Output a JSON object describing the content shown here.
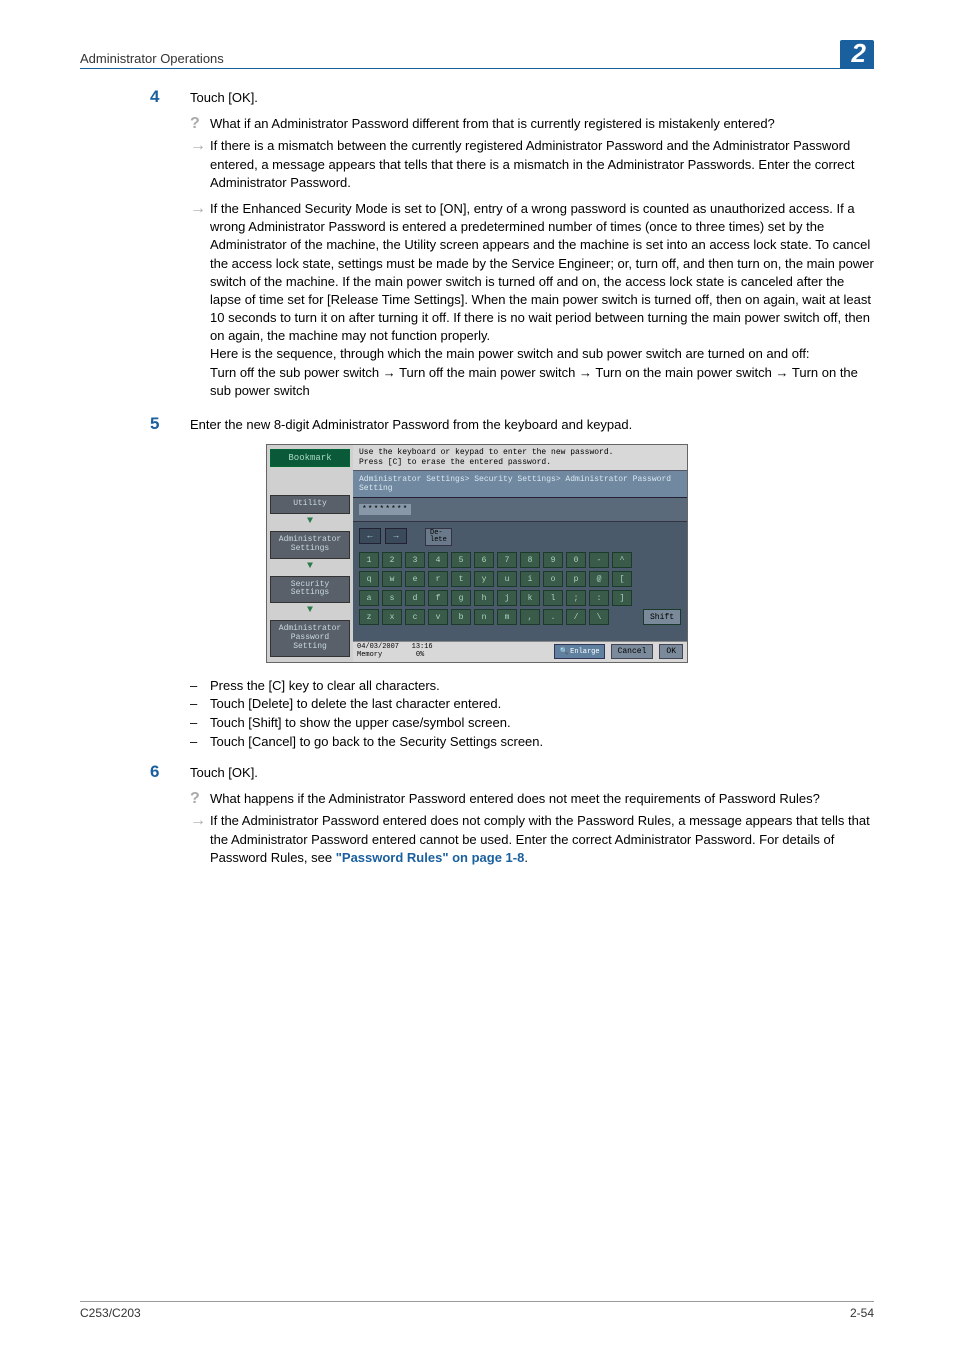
{
  "header": {
    "title": "Administrator Operations",
    "chapter": "2"
  },
  "steps": {
    "s4": {
      "num": "4",
      "text": "Touch [OK]."
    },
    "s5": {
      "num": "5",
      "text": "Enter the new 8-digit Administrator Password from the keyboard and keypad."
    },
    "s6": {
      "num": "6",
      "text": "Touch [OK]."
    }
  },
  "qa4": {
    "q": "What if an Administrator Password different from that is currently registered is mistakenly entered?",
    "a1": "If there is a mismatch between the currently registered Administrator Password and the Administrator Password entered, a message appears that tells that there is a mismatch in the Administrator Passwords. Enter the correct Administrator Password.",
    "a2a": "If the Enhanced Security Mode is set to [ON], entry of a wrong password is counted as unauthorized access. If a wrong Administrator Password is entered a predetermined number of times (once to three times) set by the Administrator of the machine, the Utility screen appears and the machine is set into an access lock state. To cancel the access lock state, settings must be made by the Service Engineer; or, turn off, and then turn on, the main power switch of the machine. If the main power switch is turned off and on, the access lock state is canceled after the lapse of time set for [Release Time Settings]. When the main power switch is turned off, then on again, wait at least 10 seconds to turn it on after turning it off. If there is no wait period between turning the main power switch off, then on again, the machine may not function properly.",
    "a2b": "Here is the sequence, through which the main power switch and sub power switch are turned on and off:",
    "a2c": "Turn off the sub power switch → Turn off the main power switch → Turn on the main power switch → Turn on the sub power switch"
  },
  "bullets5": {
    "b1": "Press the [C] key to clear all characters.",
    "b2": "Touch [Delete] to delete the last character entered.",
    "b3": "Touch [Shift] to show the upper case/symbol screen.",
    "b4": "Touch [Cancel] to go back to the Security Settings screen."
  },
  "qa6": {
    "q": "What happens if the Administrator Password entered does not meet the requirements of Password Rules?",
    "a_pre": "If the Administrator Password entered does not comply with the Password Rules, a message appears that tells that the Administrator Password entered cannot be used. Enter the correct Administrator Password. For details of Password Rules, see ",
    "a_link": "\"Password Rules\" on page 1-8",
    "a_post": "."
  },
  "screenshot": {
    "instr1": "Use the keyboard or keypad to enter the new password.",
    "instr2": "Press [C] to erase the entered password.",
    "breadcrumb": "Administrator Settings> Security Settings> Administrator Password Setting",
    "input_value": "********",
    "bookmark": "Bookmark",
    "side": {
      "utility": "Utility",
      "admin": "Administrator Settings",
      "security": "Security Settings",
      "pwd": "Administrator Password Setting"
    },
    "nav": {
      "left": "←",
      "right": "→",
      "delete": "De-\nlete"
    },
    "rows": {
      "r1": [
        "1",
        "2",
        "3",
        "4",
        "5",
        "6",
        "7",
        "8",
        "9",
        "0",
        "-",
        "^"
      ],
      "r2": [
        "q",
        "w",
        "e",
        "r",
        "t",
        "y",
        "u",
        "i",
        "o",
        "p",
        "@",
        "["
      ],
      "r3": [
        "a",
        "s",
        "d",
        "f",
        "g",
        "h",
        "j",
        "k",
        "l",
        ";",
        ":",
        "]"
      ],
      "r4": [
        "z",
        "x",
        "c",
        "v",
        "b",
        "n",
        "m",
        ",",
        ".",
        "/",
        "\\"
      ]
    },
    "shift": "Shift",
    "bottom": {
      "date": "04/03/2007",
      "time": "13:16",
      "mem_label": "Memory",
      "mem_val": "0%",
      "enlarge": "Enlarge",
      "cancel": "Cancel",
      "ok": "OK"
    }
  },
  "footer": {
    "left": "C253/C203",
    "right": "2-54"
  }
}
